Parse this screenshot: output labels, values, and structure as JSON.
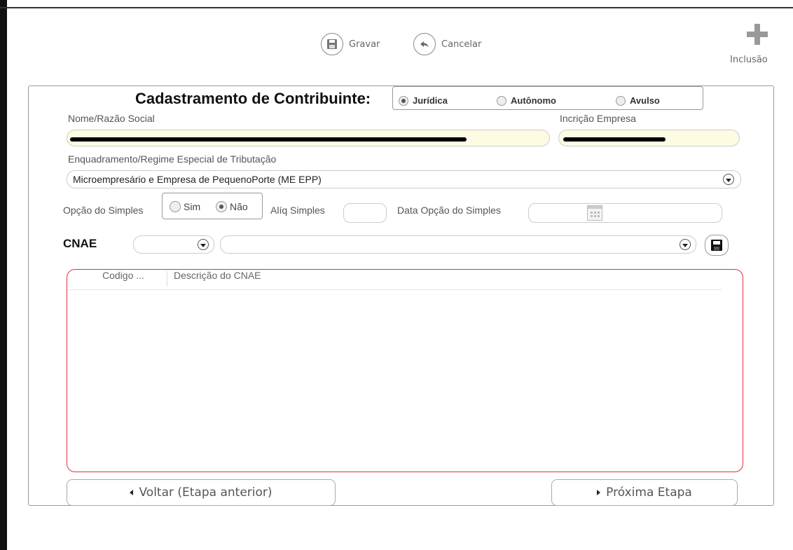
{
  "toolbar": {
    "gravar_label": "Gravar",
    "cancelar_label": "Cancelar",
    "inclusao_label": "Inclusão",
    "gravar_icon": "floppy-disk-icon",
    "cancelar_icon": "undo-arrow-icon",
    "inclusao_icon": "plus-icon"
  },
  "form": {
    "title": "Cadastramento de Contribuinte:",
    "tipo_options": [
      {
        "label": "Jurídica",
        "selected": true
      },
      {
        "label": "Autônomo",
        "selected": false
      },
      {
        "label": "Avulso",
        "selected": false
      }
    ],
    "nome_label": "Nome/Razão Social",
    "inscricao_label": "Incrição Empresa",
    "enquadramento_label": "Enquadramento/Regime Especial de Tributação",
    "enquadramento_value": "Microempresário e Empresa de PequenoPorte (ME EPP)",
    "opcao_simples_label": "Opção do Simples",
    "simples_options": [
      {
        "label": "Sim",
        "selected": false
      },
      {
        "label": "Não",
        "selected": true
      }
    ],
    "aliq_label": "Alíq Simples",
    "data_opcao_label": "Data Opção do Simples",
    "cnae_label": "CNAE"
  },
  "grid": {
    "columns": [
      "Codigo ...",
      "Descrição do CNAE"
    ],
    "rows": []
  },
  "nav": {
    "back_label": "Voltar (Etapa anterior)",
    "next_label": "Próxima Etapa"
  },
  "colors": {
    "field_highlight": "#fdfbe2",
    "grid_border": "#dd3333"
  }
}
